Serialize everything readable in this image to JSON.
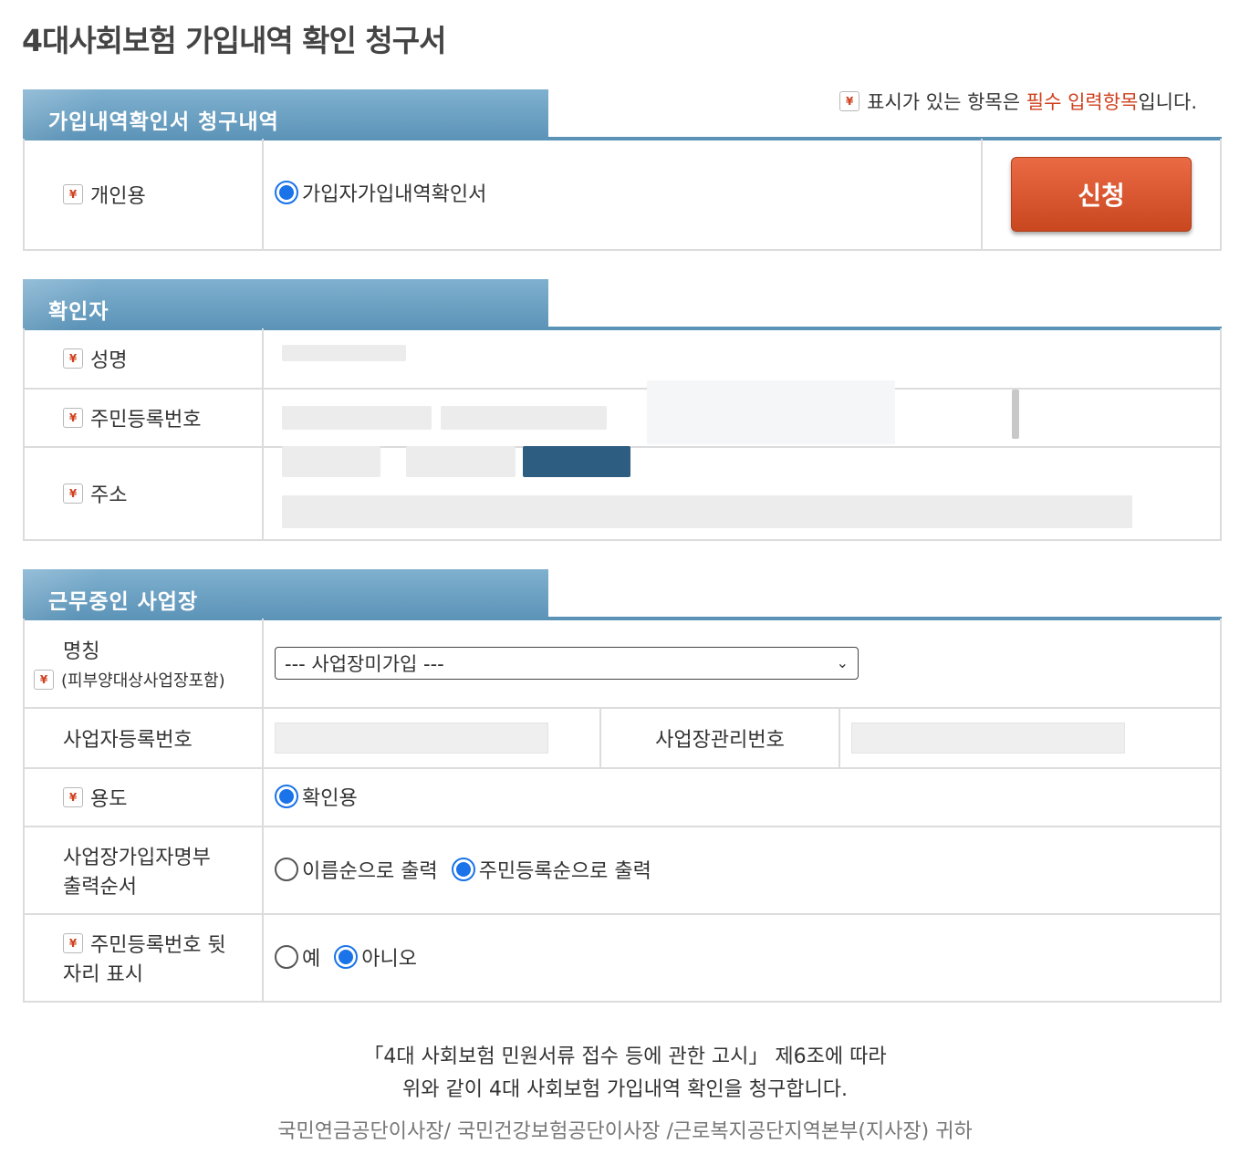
{
  "page_title": "4대사회보험 가입내역 확인 청구서",
  "required_note": {
    "prefix": "표시가 있는 항목은 ",
    "emphasis": "필수 입력항목",
    "suffix": "입니다."
  },
  "req_mark_glyph": "¥",
  "section1": {
    "title": "가입내역확인서 청구내역",
    "row_label": "개인용",
    "option_label": "가입자가입내역확인서",
    "option_selected": true,
    "apply_button": "신청"
  },
  "section2": {
    "title": "확인자",
    "labels": {
      "name": "성명",
      "rrn": "주민등록번호",
      "address": "주소"
    }
  },
  "section3": {
    "title": "근무중인 사업장",
    "company_label": "명칭",
    "company_sub": "(피부양대상사업장포함)",
    "company_select_value": "--- 사업장미가입 ---",
    "biz_reg_label": "사업자등록번호",
    "biz_mgmt_label": "사업장관리번호",
    "purpose_label": "용도",
    "purpose_option": "확인용",
    "order_label_line1": "사업장가입자명부",
    "order_label_line2": "출력순서",
    "order_options": [
      {
        "label": "이름순으로 출력",
        "selected": false
      },
      {
        "label": "주민등록순으로 출력",
        "selected": true
      }
    ],
    "rrn_tail_label_line1": "주민등록번호 뒷",
    "rrn_tail_label_line2": "자리 표시",
    "rrn_tail_options": [
      {
        "label": "예",
        "selected": false
      },
      {
        "label": "아니오",
        "selected": true
      }
    ]
  },
  "footer": {
    "line1": "「4대 사회보험 민원서류 접수 등에 관한 고시」 제6조에 따라",
    "line2": "위와 같이 4대 사회보험 가입내역 확인을 청구합니다.",
    "line3": "국민연금공단이사장/ 국민건강보험공단이사장 /근로복지공단지역본부(지사장) 귀하"
  },
  "colors": {
    "header_blue": "#5b93b7",
    "required_red": "#d0401e",
    "button_orange": "#d9532c",
    "radio_blue": "#1a73e8"
  }
}
